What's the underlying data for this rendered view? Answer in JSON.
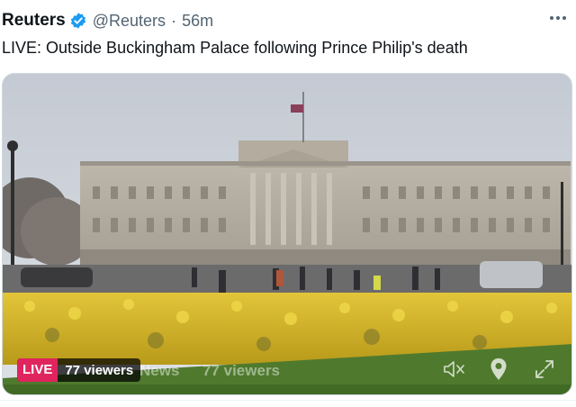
{
  "tweet": {
    "author_name": "Reuters",
    "handle": "@Reuters",
    "separator": "·",
    "time": "56m",
    "text": "LIVE: Outside Buckingham Palace following Prince Philip's death"
  },
  "media": {
    "live_label": "LIVE",
    "viewers": "77 viewers",
    "ghost_left": "News",
    "ghost_right": "77 viewers"
  },
  "icons": {
    "verified": "verified-badge-icon",
    "more": "more-dots-icon",
    "mute": "volume-muted-icon",
    "location": "location-pin-icon",
    "expand": "expand-icon"
  },
  "colors": {
    "verified": "#1d9bf0",
    "live": "#e0245e",
    "handle": "#536471"
  }
}
